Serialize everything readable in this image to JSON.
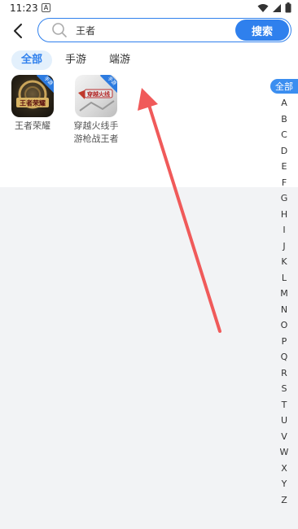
{
  "status": {
    "time": "11:23",
    "notif_letter": "A"
  },
  "header": {
    "search_value": "王者",
    "search_button": "搜索"
  },
  "tabs": [
    {
      "label": "全部",
      "active": true
    },
    {
      "label": "手游",
      "active": false
    },
    {
      "label": "端游",
      "active": false
    }
  ],
  "games": [
    {
      "title": "王者荣耀",
      "badge": "手游",
      "icon_text": "王者荣耀"
    },
    {
      "title": "穿越火线手游枪战王者",
      "badge": "手游",
      "icon_text": "穿越火线"
    }
  ],
  "alpha_index": {
    "all_label": "全部",
    "letters": [
      "A",
      "B",
      "C",
      "D",
      "E",
      "F",
      "G",
      "H",
      "I",
      "J",
      "K",
      "L",
      "M",
      "N",
      "O",
      "P",
      "Q",
      "R",
      "S",
      "T",
      "U",
      "V",
      "W",
      "X",
      "Y",
      "Z"
    ]
  },
  "colors": {
    "accent": "#2f80ed",
    "annotation_arrow": "#f05a5a"
  }
}
